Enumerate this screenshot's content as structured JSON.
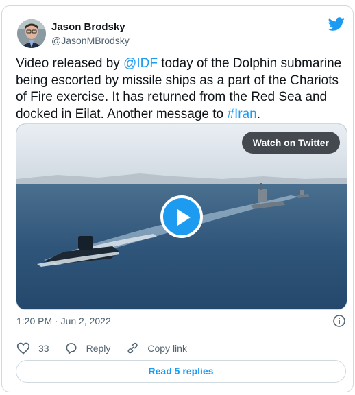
{
  "author": {
    "name": "Jason Brodsky",
    "handle": "@JasonMBrodsky"
  },
  "tweet": {
    "text_1": "Video released by ",
    "mention": "@IDF",
    "text_2": " today of the Dolphin submarine being escorted by missile ships as a part of the Chariots of Fire exercise. It has returned from the Red Sea and docked in Eilat. Another message to ",
    "hashtag": "#Iran",
    "text_3": "."
  },
  "media": {
    "watch_label": "Watch on Twitter"
  },
  "meta": {
    "timestamp": "1:20 PM · Jun 2, 2022"
  },
  "actions": {
    "like_count": "33",
    "reply_label": "Reply",
    "copy_label": "Copy link"
  },
  "footer": {
    "replies_label": "Read 5 replies"
  },
  "colors": {
    "accent": "#1d9bf0",
    "muted": "#536471",
    "border": "#cfd9de"
  }
}
